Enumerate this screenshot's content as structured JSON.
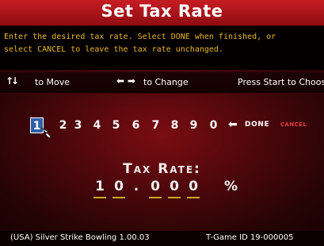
{
  "header": {
    "title": "Set Tax Rate"
  },
  "instructions": {
    "line1": "Enter the desired tax rate.  Select DONE when finished, or",
    "line2": "select CANCEL to leave the tax rate unchanged."
  },
  "nav": {
    "move_label": "to Move",
    "change_label": "to Change",
    "start_label": "Press Start to Choose"
  },
  "keypad": {
    "digits": [
      "1",
      "2",
      "3",
      "4",
      "5",
      "6",
      "7",
      "8",
      "9",
      "0"
    ],
    "selected_index": 0,
    "done_label": "DONE",
    "cancel_label": "CANCEL"
  },
  "tax": {
    "label": "Tax Rate:",
    "digits": [
      "1",
      "0",
      "0",
      "0",
      "0"
    ],
    "point": ".",
    "percent": "%"
  },
  "footer": {
    "version": "(USA) Silver Strike Bowling 1.00.03",
    "game_id": "T-Game ID 19-000005"
  },
  "colors": {
    "title_bar": "#c61c22",
    "instruction_text": "#e7b92a",
    "selected_key": "#2f5fa8",
    "cancel_text": "#e83a3a",
    "underline": "#c8aa22"
  },
  "icons": [
    "up-down-arrows-icon",
    "left-right-arrows-icon",
    "pointer-hand-icon",
    "left-arrow-icon"
  ]
}
